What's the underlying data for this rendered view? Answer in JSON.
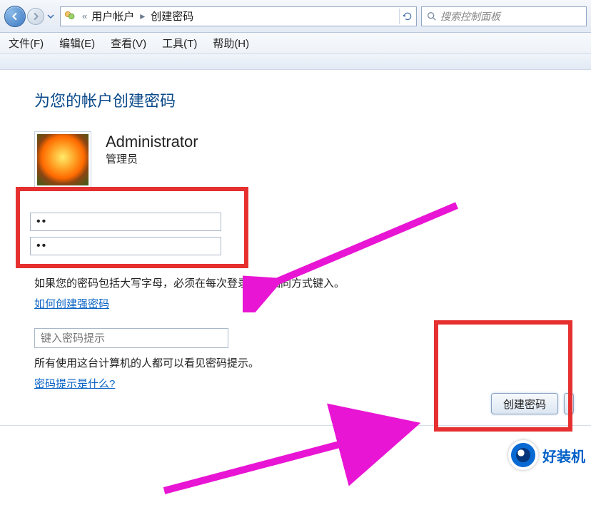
{
  "nav": {
    "crumb1": "用户帐户",
    "crumb2": "创建密码",
    "chevrons": "«"
  },
  "search": {
    "placeholder": "搜索控制面板"
  },
  "menu": {
    "file": "文件(F)",
    "edit": "编辑(E)",
    "view": "查看(V)",
    "tools": "工具(T)",
    "help": "帮助(H)"
  },
  "page": {
    "title": "为您的帐户创建密码"
  },
  "account": {
    "name": "Administrator",
    "role": "管理员"
  },
  "passwords": {
    "value1": "••",
    "value2": "••"
  },
  "notes": {
    "caps_note": "如果您的密码包括大写字母，必须在每次登录时以相同方式键入。",
    "strong_link": "如何创建强密码",
    "hint_placeholder": "键入密码提示",
    "hint_visible_note": "所有使用这台计算机的人都可以看见密码提示。",
    "hint_link": "密码提示是什么?"
  },
  "buttons": {
    "create": "创建密码"
  },
  "watermark": {
    "text": "好装机"
  }
}
